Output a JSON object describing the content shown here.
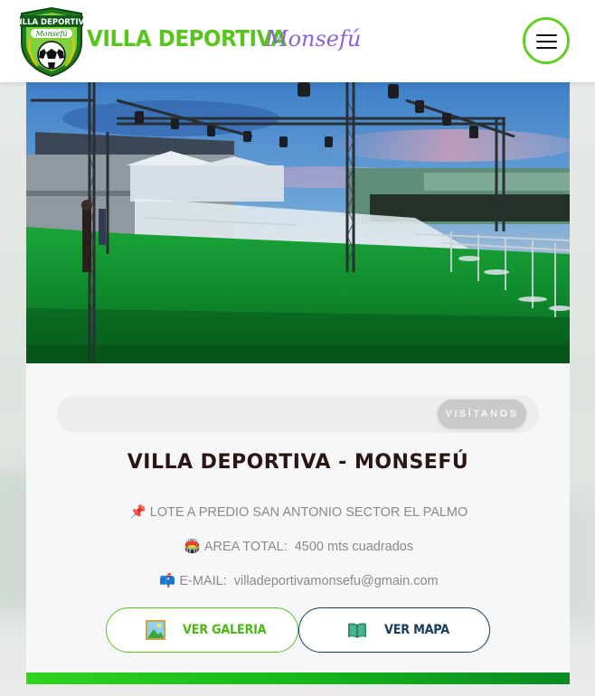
{
  "header": {
    "brand_main": "VILLA DEPORTIVA",
    "brand_script": "Monsefú",
    "logo_icon": "villa-deportiva-shield-logo",
    "menu_icon": "hamburger-menu-icon"
  },
  "hero": {
    "image_subject": "outdoor-event-venue-with-lighting-trusses"
  },
  "visit": {
    "button_label": "VISÍTANOS"
  },
  "main": {
    "title": "VILLA DEPORTIVA - MONSEFÚ",
    "address": {
      "icon": "📌",
      "text": "LOTE A PREDIO SAN ANTONIO SECTOR EL PALMO"
    },
    "area": {
      "icon": "🏟️",
      "label": "AREA TOTAL:",
      "value": "4500 mts cuadrados"
    },
    "email": {
      "icon": "📫",
      "label": "E-MAIL:",
      "value": "villadeportivamonsefu@gmain.com"
    }
  },
  "actions": {
    "gallery_label": "VER GALERIA",
    "map_label": "VER MAPA"
  },
  "colors": {
    "brand_green": "#58c41e",
    "brand_purple": "#8a63d8",
    "map_blue": "#1a3b5c"
  }
}
